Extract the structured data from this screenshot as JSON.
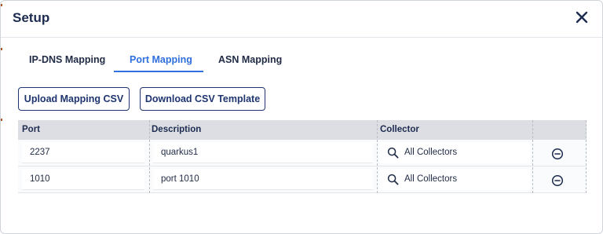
{
  "dialog": {
    "title": "Setup",
    "close_icon": "close-icon"
  },
  "tabs": [
    {
      "label": "IP-DNS Mapping",
      "active": false
    },
    {
      "label": "Port Mapping",
      "active": true
    },
    {
      "label": "ASN Mapping",
      "active": false
    }
  ],
  "actions": {
    "upload_label": "Upload Mapping CSV",
    "download_label": "Download CSV Template"
  },
  "table": {
    "columns": [
      "Port",
      "Description",
      "Collector"
    ],
    "rows": [
      {
        "port": "2237",
        "description": "quarkus1",
        "collector": "All Collectors",
        "remove_icon": "minus-circle-icon"
      },
      {
        "port": "1010",
        "description": "port 1010",
        "collector": "All Collectors",
        "remove_icon": "minus-circle-icon"
      }
    ]
  },
  "colors": {
    "accent": "#2f6fde",
    "primary_text": "#1c2b4f",
    "header_bg": "#dcdee3"
  }
}
